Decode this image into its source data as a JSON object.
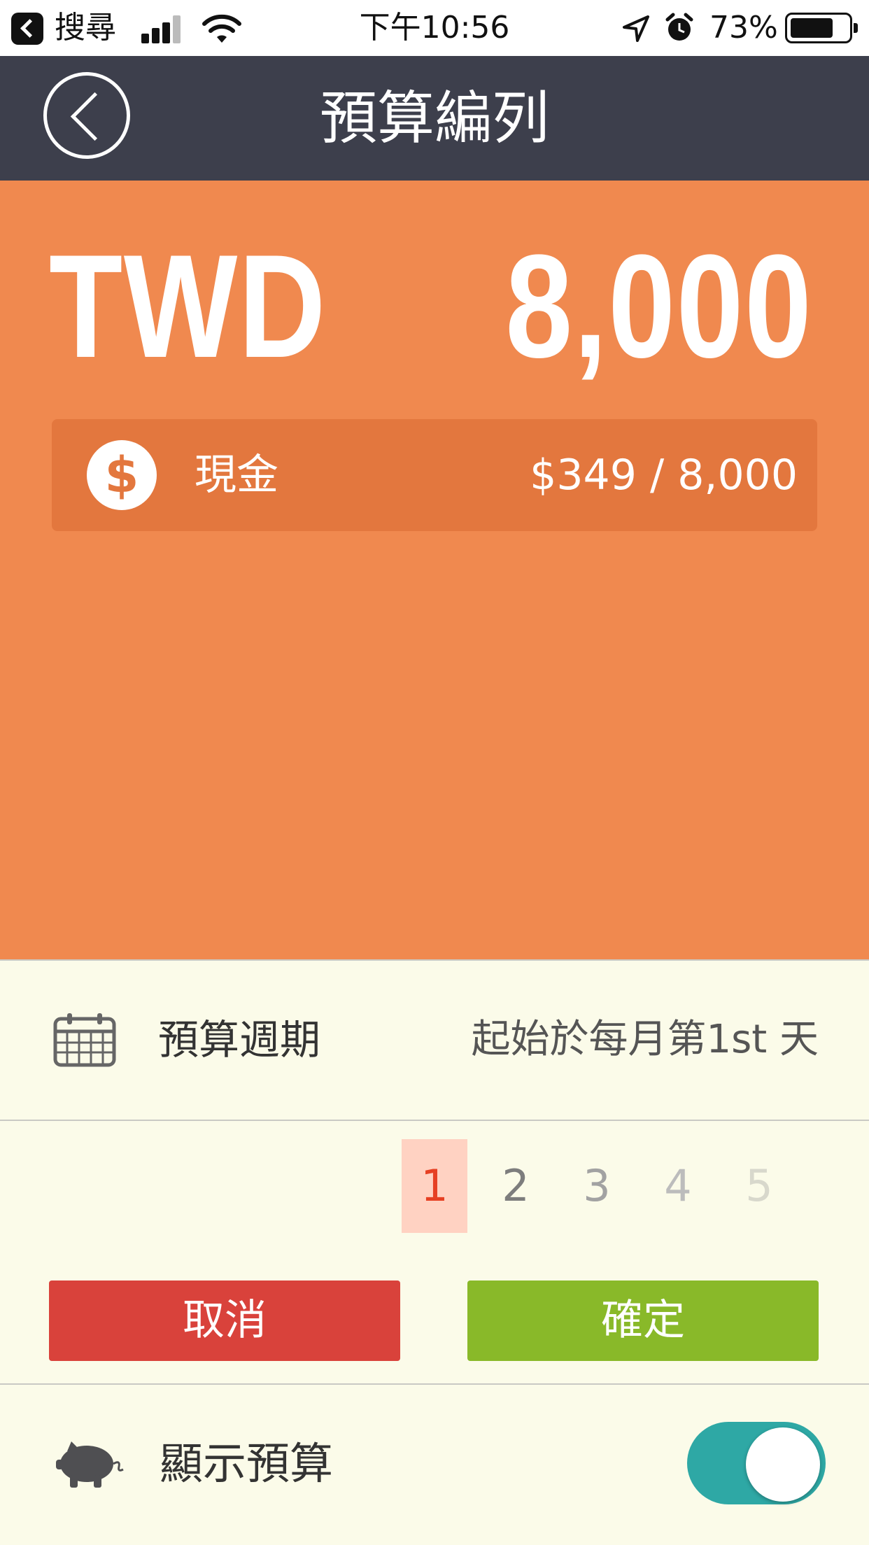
{
  "status_bar": {
    "back_app": "搜尋",
    "time": "下午10:56",
    "battery": "73%"
  },
  "nav": {
    "title": "預算編列"
  },
  "budget": {
    "currency": "TWD",
    "amount": "8,000",
    "account": {
      "name": "現金",
      "icon_glyph": "$",
      "value": "$349 / 8,000"
    }
  },
  "period": {
    "label": "預算週期",
    "value": "起始於每月第1st 天"
  },
  "picker": {
    "selected": "1",
    "options": [
      "1",
      "2",
      "3",
      "4",
      "5"
    ]
  },
  "buttons": {
    "cancel": "取消",
    "confirm": "確定"
  },
  "show_budget": {
    "label": "顯示預算",
    "enabled": true
  },
  "colors": {
    "nav_bg": "#3d3f4c",
    "orange": "#f0894f",
    "cancel": "#d9423b",
    "confirm": "#89b929",
    "toggle": "#2ea8a5"
  }
}
